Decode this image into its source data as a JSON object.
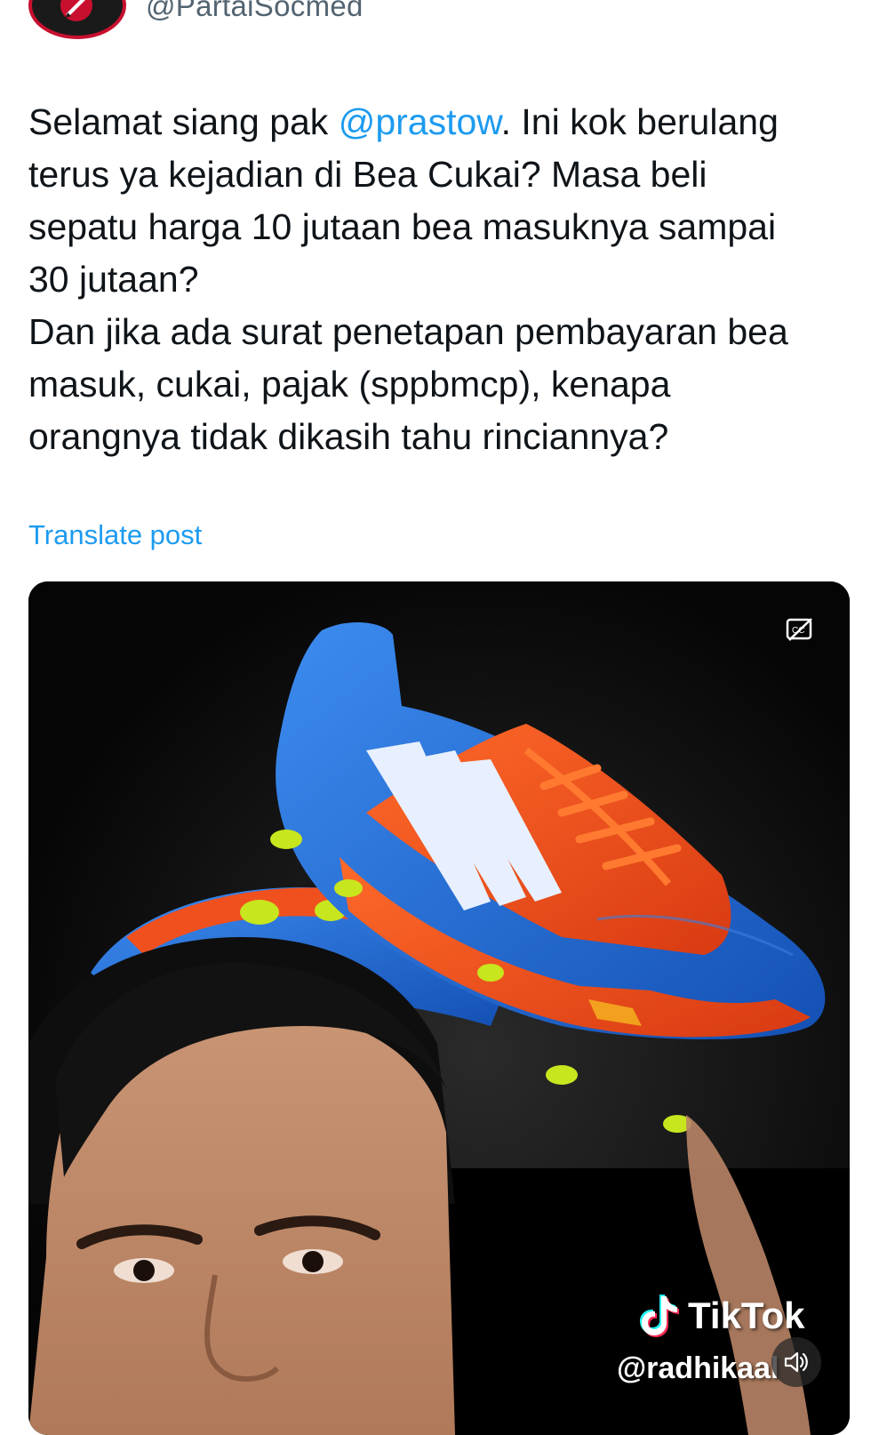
{
  "author": {
    "handle": "@PartaiSocmed",
    "avatar_icon": "partai-socmed-logo-icon"
  },
  "post": {
    "lines": [
      {
        "before": "Selamat siang pak ",
        "mention": "@prastow",
        "after": ". Ini kok berulang"
      },
      {
        "text": "terus ya kejadian di Bea Cukai? Masa beli"
      },
      {
        "text": "sepatu harga 10 jutaan bea masuknya sampai"
      },
      {
        "text": "30 jutaan?"
      },
      {
        "text": "Dan jika ada surat penetapan pembayaran bea"
      },
      {
        "text": "masuk, cukai, pajak (sppbmcp), kenapa"
      },
      {
        "text": "orangnya tidak dikasih tahu rinciannya?"
      }
    ],
    "translate_label": "Translate post"
  },
  "media": {
    "type": "video",
    "captions_icon": "closed-captions-off-icon",
    "watermark_brand": "TikTok",
    "watermark_user": "@radhikaal",
    "volume_icon": "speaker-icon",
    "colors": {
      "shoe_blue": "#1f6fd6",
      "shoe_orange": "#f0501e",
      "stud_yellow": "#c8e61e",
      "background": "#050505"
    }
  }
}
